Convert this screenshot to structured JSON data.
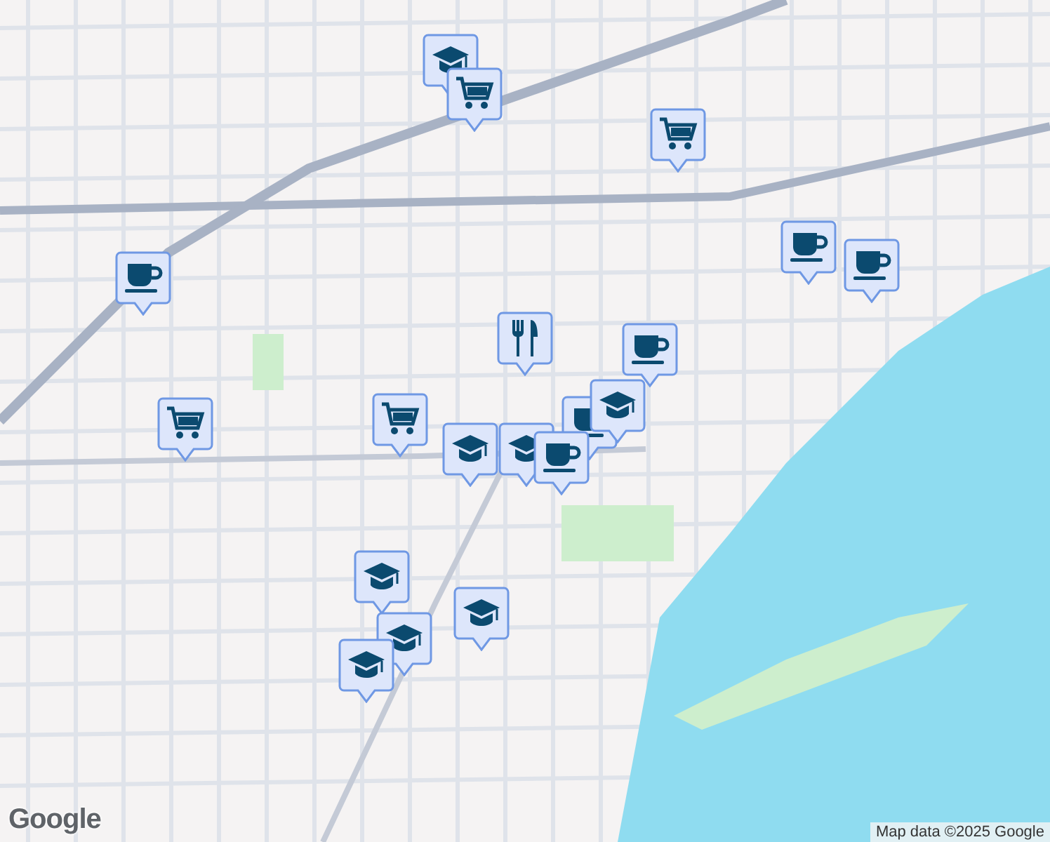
{
  "markers": [
    {
      "kind": "school"
    },
    {
      "kind": "cart"
    },
    {
      "kind": "cart"
    },
    {
      "kind": "coffee"
    },
    {
      "kind": "coffee"
    },
    {
      "kind": "coffee"
    },
    {
      "kind": "food"
    },
    {
      "kind": "coffee"
    },
    {
      "kind": "cart"
    },
    {
      "kind": "cart"
    },
    {
      "kind": "coffee"
    },
    {
      "kind": "school"
    },
    {
      "kind": "school"
    },
    {
      "kind": "school"
    },
    {
      "kind": "coffee"
    },
    {
      "kind": "school"
    },
    {
      "kind": "school"
    },
    {
      "kind": "school"
    },
    {
      "kind": "school"
    }
  ],
  "logo": "Google",
  "attribution": "Map data ©2025 Google"
}
